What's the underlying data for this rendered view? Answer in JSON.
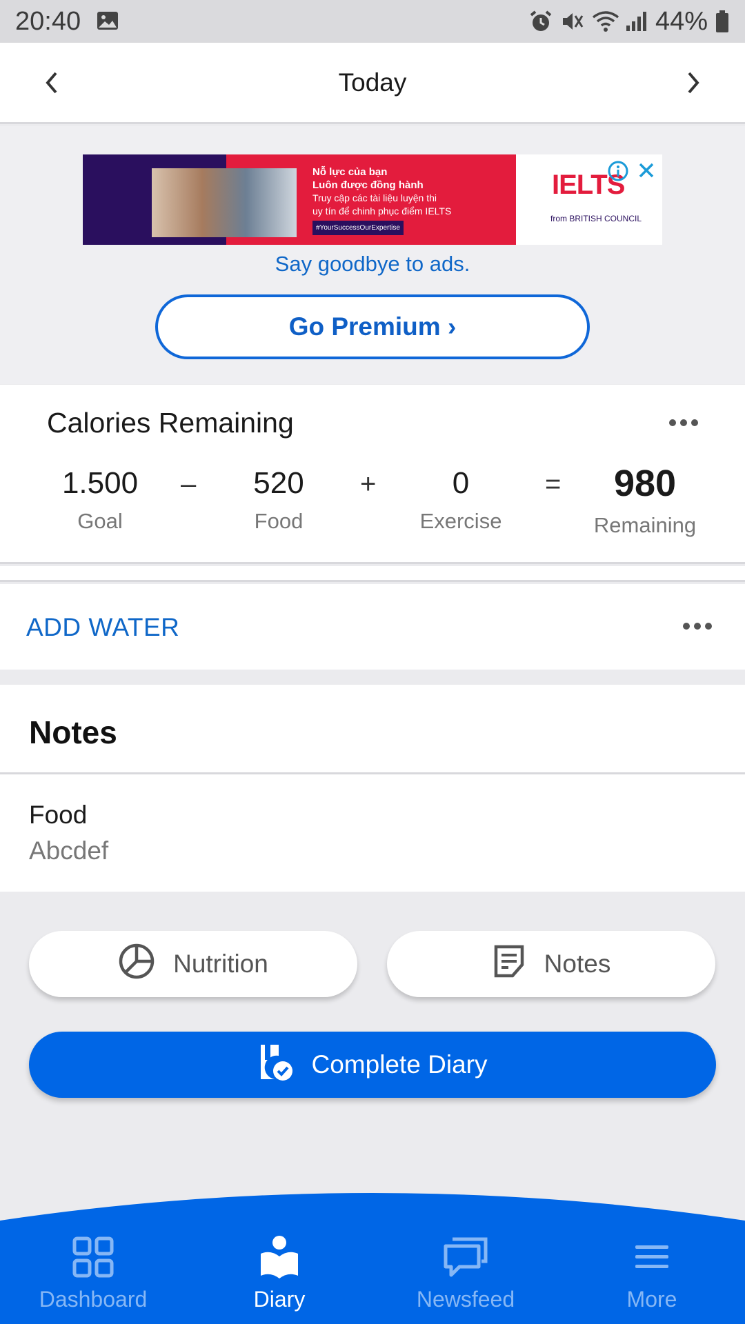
{
  "status_bar": {
    "time": "20:40",
    "battery": "44%"
  },
  "header": {
    "title": "Today"
  },
  "ad": {
    "headline_1": "Nỗ lực của bạn",
    "headline_2": "Luôn được đồng hành",
    "body_1": "Truy cập các tài liệu luyện thi",
    "body_2": "uy tín để chinh phục điểm IELTS",
    "hashtag": "#YourSuccessOurExpertise",
    "brand": "IELTS",
    "from": "from BRITISH COUNCIL",
    "slogan": "Say goodbye to ads.",
    "premium_label": "Go Premium ›"
  },
  "calories": {
    "title": "Calories Remaining",
    "goal": {
      "value": "1.500",
      "label": "Goal"
    },
    "food": {
      "value": "520",
      "label": "Food"
    },
    "exercise": {
      "value": "0",
      "label": "Exercise"
    },
    "remaining": {
      "value": "980",
      "label": "Remaining"
    },
    "ops": {
      "minus": "–",
      "plus": "+",
      "equals": "="
    }
  },
  "water": {
    "label": "ADD WATER"
  },
  "notes": {
    "title": "Notes",
    "entry_name": "Food",
    "entry_text": "Abcdef"
  },
  "actions": {
    "nutrition": "Nutrition",
    "notes": "Notes",
    "complete": "Complete Diary"
  },
  "bottom_nav": [
    {
      "label": "Dashboard",
      "icon": "dashboard-icon"
    },
    {
      "label": "Diary",
      "icon": "diary-icon"
    },
    {
      "label": "Newsfeed",
      "icon": "newsfeed-icon"
    },
    {
      "label": "More",
      "icon": "menu-icon"
    }
  ],
  "colors": {
    "accent": "#0066e6",
    "link": "#0f67c8",
    "nav_inactive": "#86b7f5"
  }
}
